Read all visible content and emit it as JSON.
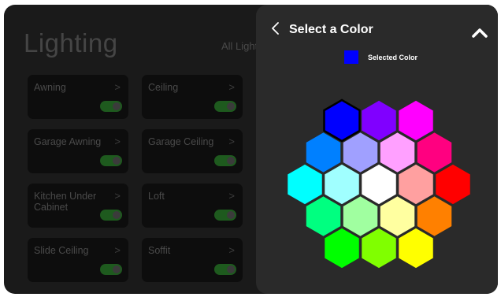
{
  "lighting": {
    "title": "Lighting",
    "all_lights": "All Light",
    "cards": [
      {
        "label": "Awning",
        "on": true
      },
      {
        "label": "Ceiling",
        "on": true
      },
      {
        "label": "Garage Awning",
        "on": true
      },
      {
        "label": "Garage Ceiling",
        "on": true
      },
      {
        "label": "Kitchen Under Cabinet",
        "on": true
      },
      {
        "label": "Loft",
        "on": true
      },
      {
        "label": "Slide Ceiling",
        "on": true
      },
      {
        "label": "Soffit",
        "on": true
      }
    ],
    "chevron": ">"
  },
  "color_panel": {
    "title": "Select a Color",
    "selected_label": "Selected Color",
    "selected_color": "#0000ff",
    "back_icon": "chevron-left-icon",
    "collapse_icon": "chevron-up-icon",
    "palette": [
      [
        "#0000ff",
        "#8000ff",
        "#ff00ff"
      ],
      [
        "#0080ff",
        "#a0a0ff",
        "#ffa0ff",
        "#ff0080"
      ],
      [
        "#00ffff",
        "#a0ffff",
        "#ffffff",
        "#ffa0a0",
        "#ff0000"
      ],
      [
        "#00ff80",
        "#a0ffa0",
        "#ffffa0",
        "#ff8000"
      ],
      [
        "#00ff00",
        "#80ff00",
        "#ffff00"
      ]
    ]
  }
}
